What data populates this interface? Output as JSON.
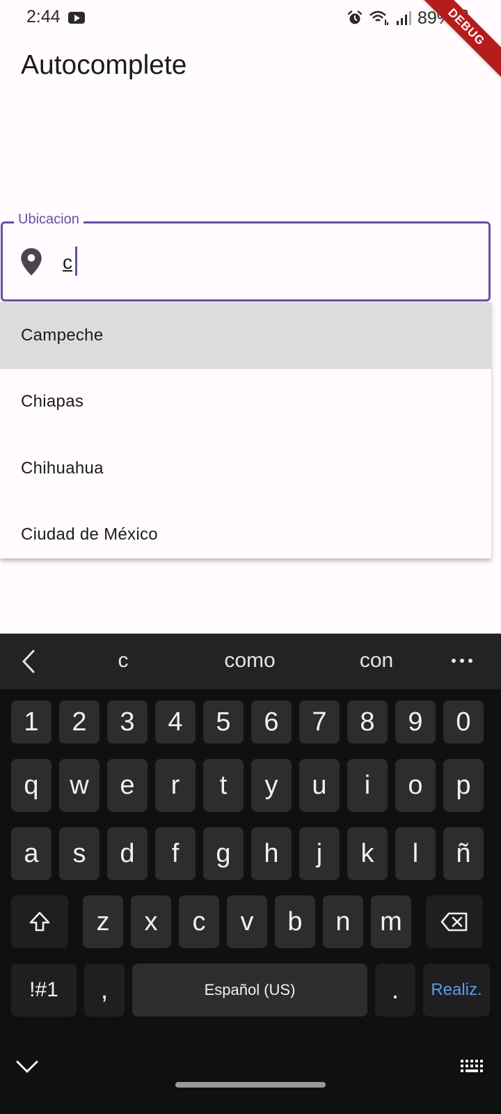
{
  "status": {
    "time": "2:44",
    "battery": "89%"
  },
  "debug_banner": "DEBUG",
  "appbar": {
    "title": "Autocomplete"
  },
  "field": {
    "label": "Ubicacion",
    "value": "c",
    "focused_color": "#6750a4"
  },
  "options": [
    "Campeche",
    "Chiapas",
    "Chihuahua",
    "Ciudad de México"
  ],
  "keyboard": {
    "suggestions": [
      "c",
      "como",
      "con"
    ],
    "row_numbers": [
      "1",
      "2",
      "3",
      "4",
      "5",
      "6",
      "7",
      "8",
      "9",
      "0"
    ],
    "row1": [
      "q",
      "w",
      "e",
      "r",
      "t",
      "y",
      "u",
      "i",
      "o",
      "p"
    ],
    "row2": [
      "a",
      "s",
      "d",
      "f",
      "g",
      "h",
      "j",
      "k",
      "l",
      "ñ"
    ],
    "row3": [
      "z",
      "x",
      "c",
      "v",
      "b",
      "n",
      "m"
    ],
    "symbols": "!#1",
    "comma": ",",
    "space": "Español (US)",
    "period": ".",
    "done": "Realiz."
  }
}
